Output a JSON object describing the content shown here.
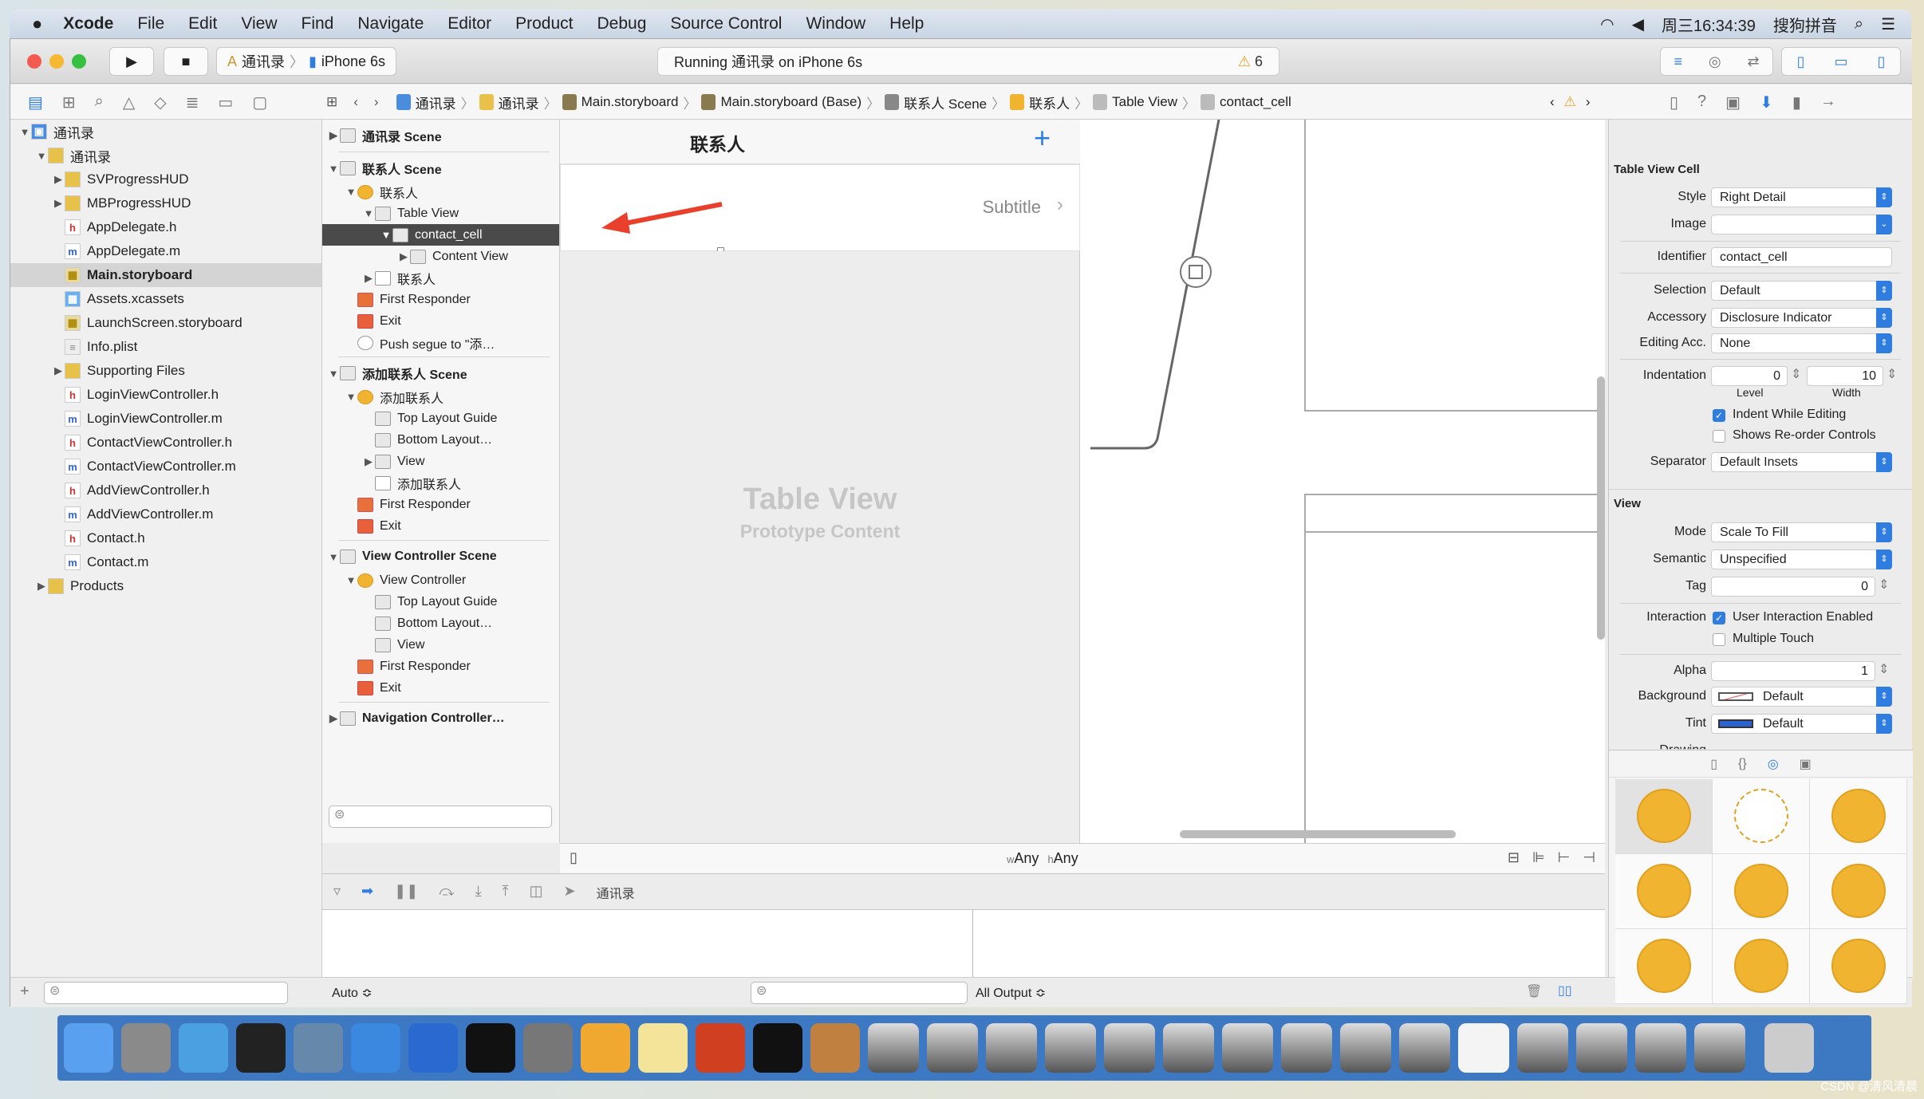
{
  "menubar": {
    "app": "Xcode",
    "items": [
      "File",
      "Edit",
      "View",
      "Find",
      "Navigate",
      "Editor",
      "Product",
      "Debug",
      "Source Control",
      "Window",
      "Help"
    ],
    "clock": "周三16:34:39",
    "input_method": "搜狗拼音"
  },
  "toolbar": {
    "scheme": "通讯录",
    "device": "iPhone 6s",
    "activity": "Running 通讯录 on iPhone 6s",
    "warnings": "6"
  },
  "jumpbar": [
    "通讯录",
    "通讯录",
    "Main.storyboard",
    "Main.storyboard (Base)",
    "联系人 Scene",
    "联系人",
    "Table View",
    "contact_cell"
  ],
  "navigator": {
    "items": [
      {
        "label": "通讯录",
        "level": 0,
        "icon": "project",
        "disclosure": "open"
      },
      {
        "label": "通讯录",
        "level": 1,
        "icon": "folder",
        "disclosure": "open"
      },
      {
        "label": "SVProgressHUD",
        "level": 2,
        "icon": "folder",
        "disclosure": "closed"
      },
      {
        "label": "MBProgressHUD",
        "level": 2,
        "icon": "folder",
        "disclosure": "closed"
      },
      {
        "label": "AppDelegate.h",
        "level": 2,
        "icon": "h"
      },
      {
        "label": "AppDelegate.m",
        "level": 2,
        "icon": "m"
      },
      {
        "label": "Main.storyboard",
        "level": 2,
        "icon": "storyboard",
        "selected": true
      },
      {
        "label": "Assets.xcassets",
        "level": 2,
        "icon": "assets"
      },
      {
        "label": "LaunchScreen.storyboard",
        "level": 2,
        "icon": "storyboard"
      },
      {
        "label": "Info.plist",
        "level": 2,
        "icon": "plist"
      },
      {
        "label": "Supporting Files",
        "level": 2,
        "icon": "folder",
        "disclosure": "closed"
      },
      {
        "label": "LoginViewController.h",
        "level": 2,
        "icon": "h"
      },
      {
        "label": "LoginViewController.m",
        "level": 2,
        "icon": "m"
      },
      {
        "label": "ContactViewController.h",
        "level": 2,
        "icon": "h"
      },
      {
        "label": "ContactViewController.m",
        "level": 2,
        "icon": "m"
      },
      {
        "label": "AddViewController.h",
        "level": 2,
        "icon": "h"
      },
      {
        "label": "AddViewController.m",
        "level": 2,
        "icon": "m"
      },
      {
        "label": "Contact.h",
        "level": 2,
        "icon": "h"
      },
      {
        "label": "Contact.m",
        "level": 2,
        "icon": "m"
      },
      {
        "label": "Products",
        "level": 1,
        "icon": "folder",
        "disclosure": "closed"
      }
    ]
  },
  "outline": {
    "items": [
      {
        "label": "通讯录 Scene",
        "level": 0,
        "header": true,
        "disclosure": "closed"
      },
      {
        "sep": true
      },
      {
        "label": "联系人 Scene",
        "level": 0,
        "header": true,
        "disclosure": "open"
      },
      {
        "label": "联系人",
        "level": 1,
        "icon": "controller",
        "disclosure": "open"
      },
      {
        "label": "Table View",
        "level": 2,
        "icon": "view",
        "disclosure": "open"
      },
      {
        "label": "contact_cell",
        "level": 3,
        "icon": "cell",
        "disclosure": "open",
        "selected": true
      },
      {
        "label": "Content View",
        "level": 4,
        "icon": "view",
        "disclosure": "closed"
      },
      {
        "label": "联系人",
        "level": 2,
        "icon": "navitem",
        "disclosure": "closed"
      },
      {
        "label": "First Responder",
        "level": 1,
        "icon": "responder"
      },
      {
        "label": "Exit",
        "level": 1,
        "icon": "exit"
      },
      {
        "label": "Push segue to \"添…",
        "level": 1,
        "icon": "segue"
      },
      {
        "sep": true
      },
      {
        "label": "添加联系人 Scene",
        "level": 0,
        "header": true,
        "disclosure": "open"
      },
      {
        "label": "添加联系人",
        "level": 1,
        "icon": "controller",
        "disclosure": "open"
      },
      {
        "label": "Top Layout Guide",
        "level": 2,
        "icon": "view"
      },
      {
        "label": "Bottom Layout…",
        "level": 2,
        "icon": "view"
      },
      {
        "label": "View",
        "level": 2,
        "icon": "view",
        "disclosure": "closed"
      },
      {
        "label": "添加联系人",
        "level": 2,
        "icon": "navitem"
      },
      {
        "label": "First Responder",
        "level": 1,
        "icon": "responder"
      },
      {
        "label": "Exit",
        "level": 1,
        "icon": "exit"
      },
      {
        "sep": true
      },
      {
        "label": "View Controller Scene",
        "level": 0,
        "header": true,
        "disclosure": "open"
      },
      {
        "label": "View Controller",
        "level": 1,
        "icon": "controller",
        "disclosure": "open"
      },
      {
        "label": "Top Layout Guide",
        "level": 2,
        "icon": "view"
      },
      {
        "label": "Bottom Layout…",
        "level": 2,
        "icon": "view"
      },
      {
        "label": "View",
        "level": 2,
        "icon": "view"
      },
      {
        "label": "First Responder",
        "level": 1,
        "icon": "responder"
      },
      {
        "label": "Exit",
        "level": 1,
        "icon": "exit"
      },
      {
        "sep": true
      },
      {
        "label": "Navigation Controller…",
        "level": 0,
        "header": true,
        "disclosure": "closed"
      }
    ]
  },
  "canvas": {
    "nav_title": "联系人",
    "cell_detail": "Subtitle",
    "table_title": "Table View",
    "table_subtitle": "Prototype Content",
    "size_class": {
      "w_prefix": "w",
      "w": "Any",
      "h_prefix": "h",
      "h": "Any"
    }
  },
  "debugbar": {
    "target": "通讯录"
  },
  "bottombar": {
    "auto": "Auto ≎",
    "output": "All Output ≎"
  },
  "inspector": {
    "cell_section": "Table View Cell",
    "style_label": "Style",
    "style": "Right Detail",
    "image_label": "Image",
    "image": "",
    "identifier_label": "Identifier",
    "identifier": "contact_cell",
    "selection_label": "Selection",
    "selection": "Default",
    "accessory_label": "Accessory",
    "accessory": "Disclosure Indicator",
    "editing_acc_label": "Editing Acc.",
    "editing_acc": "None",
    "indentation_label": "Indentation",
    "level": "0",
    "level_label": "Level",
    "width": "10",
    "width_label": "Width",
    "indent_while_editing": "Indent While Editing",
    "indent_checked": true,
    "shows_reorder": "Shows Re-order Controls",
    "reorder_checked": false,
    "separator_label": "Separator",
    "separator": "Default Insets",
    "view_section": "View",
    "mode_label": "Mode",
    "mode": "Scale To Fill",
    "semantic_label": "Semantic",
    "semantic": "Unspecified",
    "tag_label": "Tag",
    "tag": "0",
    "interaction_label": "Interaction",
    "user_interaction": "User Interaction Enabled",
    "user_interaction_checked": true,
    "multiple_touch": "Multiple Touch",
    "multiple_touch_checked": false,
    "alpha_label": "Alpha",
    "alpha": "1",
    "background_label": "Background",
    "background": "Default",
    "tint_label": "Tint",
    "tint": "Default",
    "drawing_label": "Drawing"
  },
  "watermark": "CSDN @清风清晨",
  "colors": {
    "accent": "#2f7de1",
    "arrow": "#e8402a",
    "library": "#f1b431"
  }
}
